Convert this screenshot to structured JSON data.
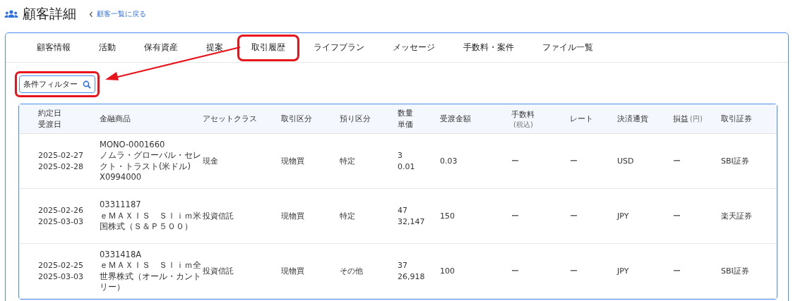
{
  "header": {
    "title": "顧客詳細",
    "back_link": "顧客一覧に戻る"
  },
  "tabs": [
    {
      "label": "顧客情報",
      "highlighted": false
    },
    {
      "label": "活動",
      "highlighted": false
    },
    {
      "label": "保有資産",
      "highlighted": false
    },
    {
      "label": "提案",
      "highlighted": false
    },
    {
      "label": "取引履歴",
      "highlighted": true
    },
    {
      "label": "ライフプラン",
      "highlighted": false
    },
    {
      "label": "メッセージ",
      "highlighted": false
    },
    {
      "label": "手数料・案件",
      "highlighted": false
    },
    {
      "label": "ファイル一覧",
      "highlighted": false
    }
  ],
  "filter": {
    "label": "条件フィルター",
    "highlighted": true
  },
  "table": {
    "columns": [
      {
        "lines": [
          "約定日",
          "受渡日"
        ]
      },
      {
        "lines": [
          "金融商品"
        ]
      },
      {
        "lines": [
          "アセットクラス"
        ]
      },
      {
        "lines": [
          "取引区分"
        ]
      },
      {
        "lines": [
          "預り区分"
        ]
      },
      {
        "lines": [
          "数量",
          "単価"
        ]
      },
      {
        "lines": [
          "受渡金額"
        ]
      },
      {
        "lines": [
          "手数料"
        ],
        "note": "(税込)",
        "note_inline": false
      },
      {
        "lines": [
          "レート"
        ]
      },
      {
        "lines": [
          "決済通貨"
        ]
      },
      {
        "lines": [
          "損益"
        ],
        "note": "(円)",
        "note_inline": true
      },
      {
        "lines": [
          "取引証券"
        ]
      }
    ],
    "rows": [
      {
        "cells": [
          [
            "2025-02-27",
            "2025-02-28"
          ],
          [
            "MONO-0001660",
            "ノムラ・グローバル・セレクト・トラスト(米ドル)",
            "X0994000"
          ],
          [
            "現金"
          ],
          [
            "現物買"
          ],
          [
            "特定"
          ],
          [
            "3",
            "0.01"
          ],
          [
            "0.03"
          ],
          [
            "ー"
          ],
          [
            "ー"
          ],
          [
            "USD"
          ],
          [
            "ー"
          ],
          [
            "SBI証券"
          ]
        ]
      },
      {
        "cells": [
          [
            "2025-02-26",
            "2025-03-03"
          ],
          [
            "03311187",
            "ｅＭＡＸＩＳ　Ｓｌｉｍ米国株式（Ｓ＆Ｐ５００）"
          ],
          [
            "投資信託"
          ],
          [
            "現物買"
          ],
          [
            "特定"
          ],
          [
            "47",
            "32,147"
          ],
          [
            "150"
          ],
          [
            "ー"
          ],
          [
            "ー"
          ],
          [
            "JPY"
          ],
          [
            "ー"
          ],
          [
            "楽天証券"
          ]
        ]
      },
      {
        "cells": [
          [
            "2025-02-25",
            "2025-03-03"
          ],
          [
            "0331418A",
            "ｅＭＡＸＩＳ　Ｓｌｉｍ全世界株式（オール・カントリー）"
          ],
          [
            "投資信託"
          ],
          [
            "現物買"
          ],
          [
            "その他"
          ],
          [
            "37",
            "26,918"
          ],
          [
            "100"
          ],
          [
            "ー"
          ],
          [
            "ー"
          ],
          [
            "JPY"
          ],
          [
            "ー"
          ],
          [
            "SBI証券"
          ]
        ]
      }
    ]
  }
}
